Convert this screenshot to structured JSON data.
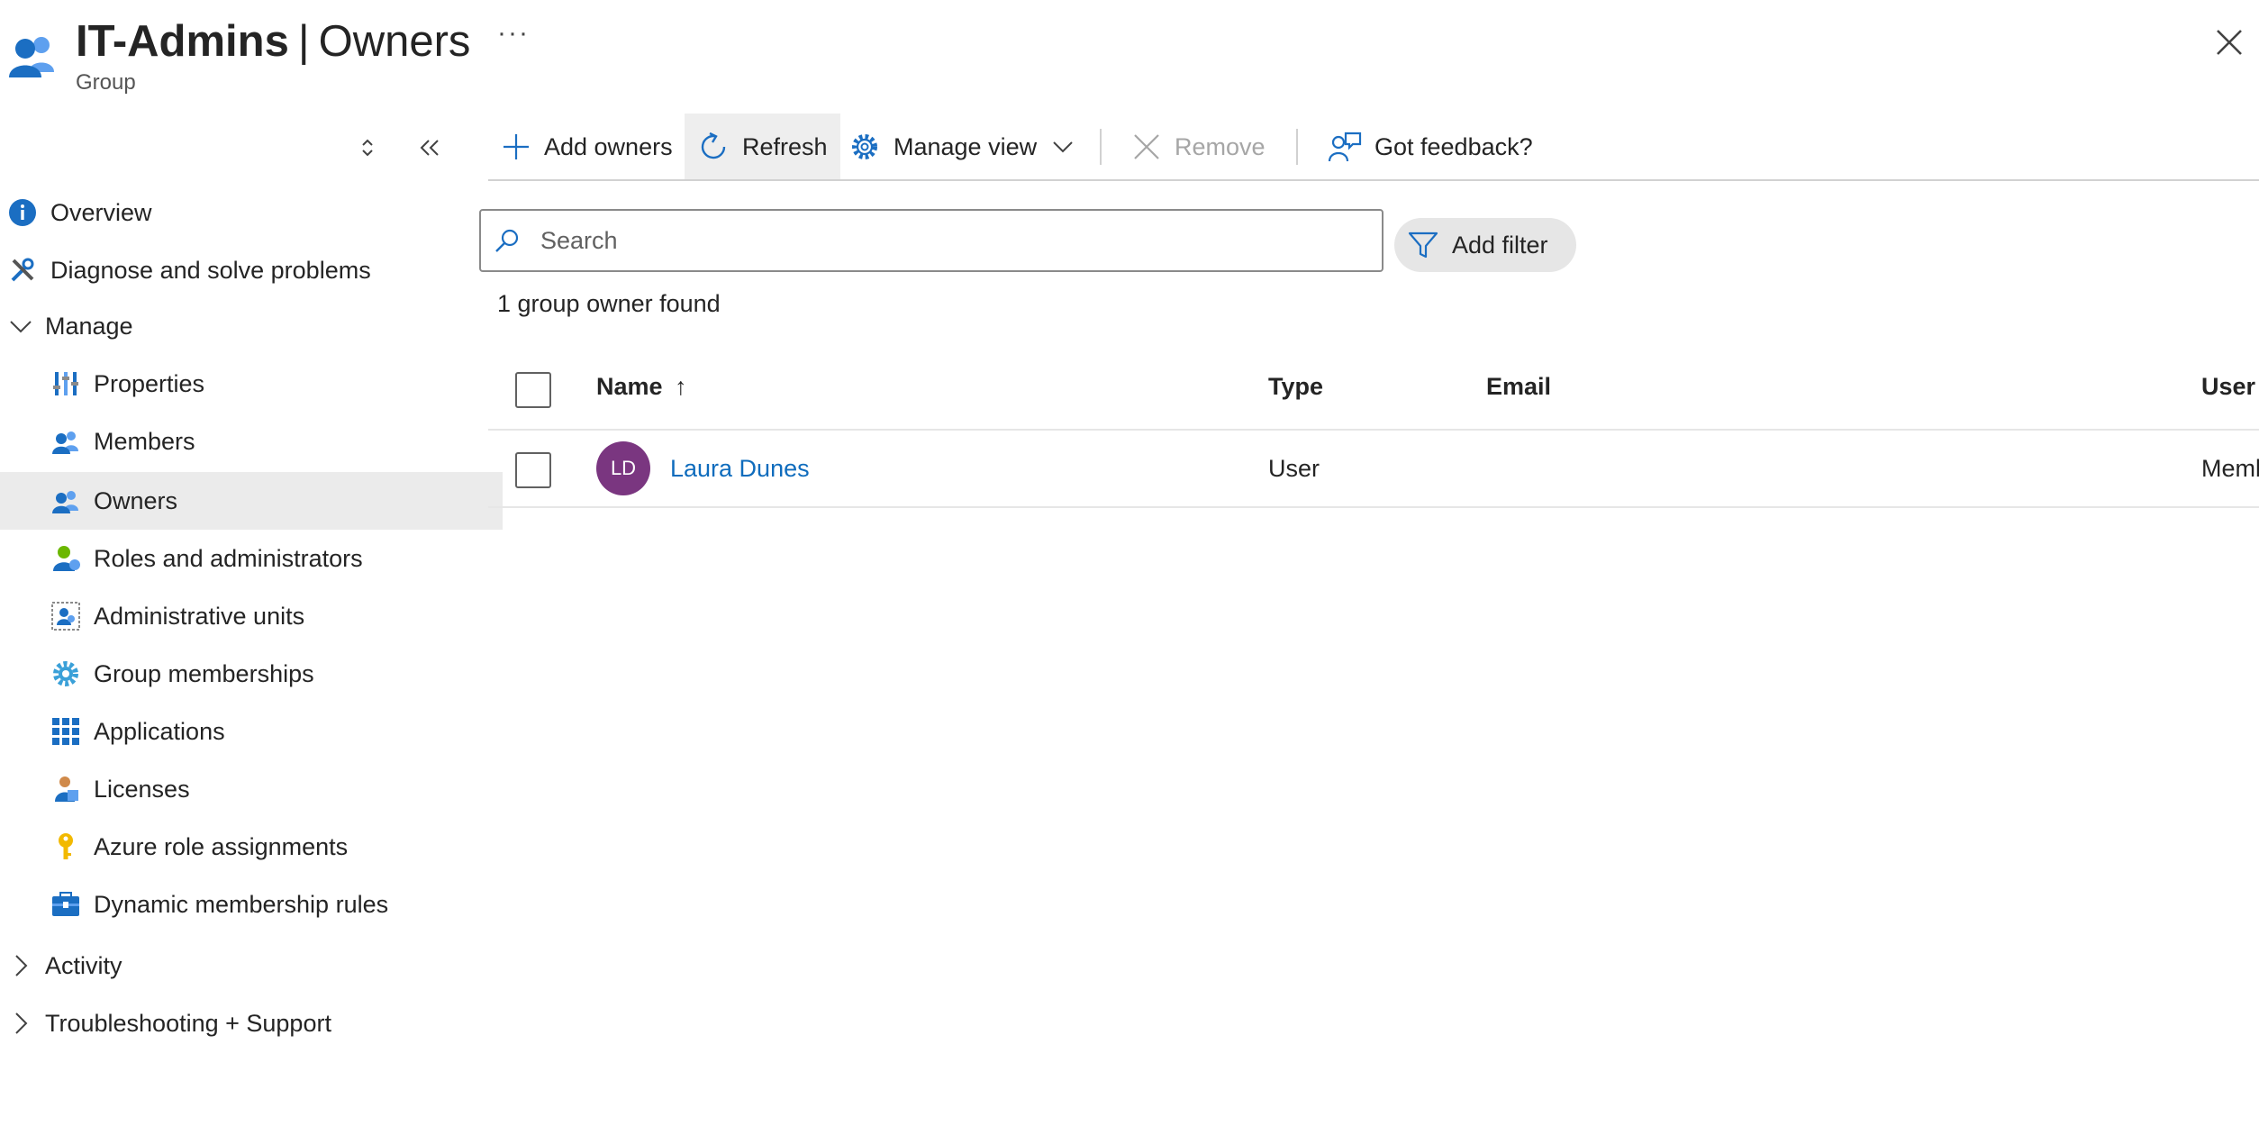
{
  "header": {
    "title_bold": "IT-Admins",
    "title_separator": "|",
    "title_section": "Owners",
    "subtitle": "Group",
    "more_glyph": "···",
    "icon": "group-icon"
  },
  "sidebar": {
    "items": [
      {
        "label": "Overview",
        "icon": "info-icon"
      },
      {
        "label": "Diagnose and solve problems",
        "icon": "wrench-icon"
      },
      {
        "label": "Manage",
        "icon": "chevron-down-icon",
        "expanded": true
      },
      {
        "label": "Properties",
        "icon": "properties-icon"
      },
      {
        "label": "Members",
        "icon": "members-icon"
      },
      {
        "label": "Owners",
        "icon": "owners-icon",
        "selected": true
      },
      {
        "label": "Roles and administrators",
        "icon": "roles-icon"
      },
      {
        "label": "Administrative units",
        "icon": "admin-units-icon"
      },
      {
        "label": "Group memberships",
        "icon": "gear-icon"
      },
      {
        "label": "Applications",
        "icon": "applications-grid-icon"
      },
      {
        "label": "Licenses",
        "icon": "licenses-icon"
      },
      {
        "label": "Azure role assignments",
        "icon": "key-icon"
      },
      {
        "label": "Dynamic membership rules",
        "icon": "dynamic-rules-icon"
      },
      {
        "label": "Activity",
        "icon": "chevron-right-icon",
        "expanded": false
      },
      {
        "label": "Troubleshooting + Support",
        "icon": "chevron-right-icon",
        "expanded": false
      }
    ]
  },
  "toolbar": {
    "add_owners": "Add owners",
    "refresh": "Refresh",
    "manage_view": "Manage view",
    "remove": "Remove",
    "feedback": "Got feedback?"
  },
  "search": {
    "placeholder": "Search",
    "value": ""
  },
  "filter": {
    "add_filter_label": "Add filter"
  },
  "results": {
    "count_text": "1 group owner found"
  },
  "table": {
    "columns": {
      "name": "Name",
      "name_sort": "↑",
      "type": "Type",
      "email": "Email",
      "user_type": "User t"
    },
    "rows": [
      {
        "initials": "LD",
        "name": "Laura Dunes",
        "type": "User",
        "email": "",
        "user_type": "Memb"
      }
    ]
  },
  "colors": {
    "accent": "#0f6cbd",
    "avatar": "#7a3680",
    "selected_bg": "#ebebeb"
  }
}
